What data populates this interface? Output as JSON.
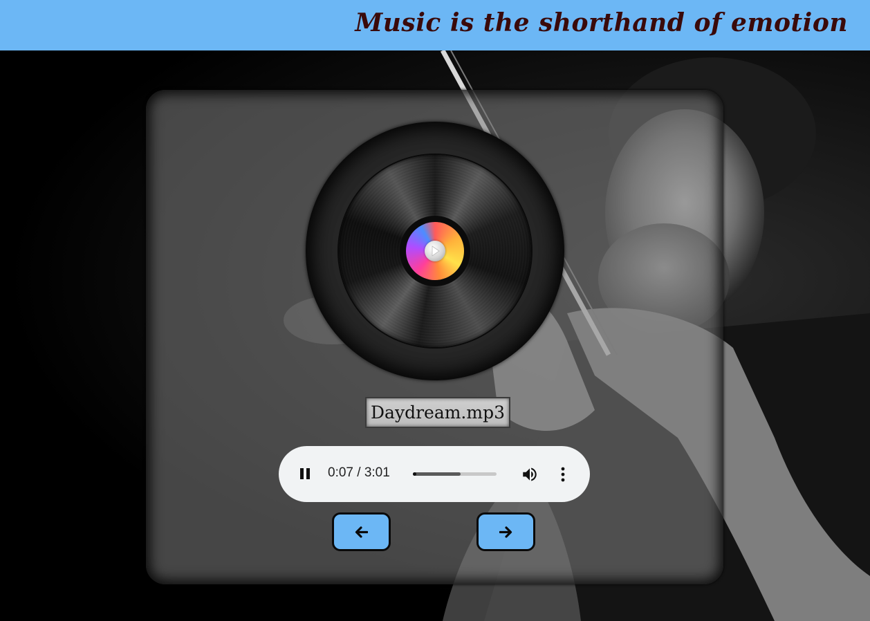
{
  "header": {
    "title": "Music is the shorthand of emotion"
  },
  "player": {
    "track_name": "Daydream.mp3",
    "audio": {
      "time_display": "0:07 / 3:01",
      "progress_fraction": 0.04,
      "buffered_fraction": 0.57,
      "state": "playing"
    },
    "prev_button_icon": "arrow-left-icon",
    "next_button_icon": "arrow-right-icon"
  },
  "colors": {
    "accent": "#6cb7f5",
    "title_text": "#3a0a0a"
  }
}
